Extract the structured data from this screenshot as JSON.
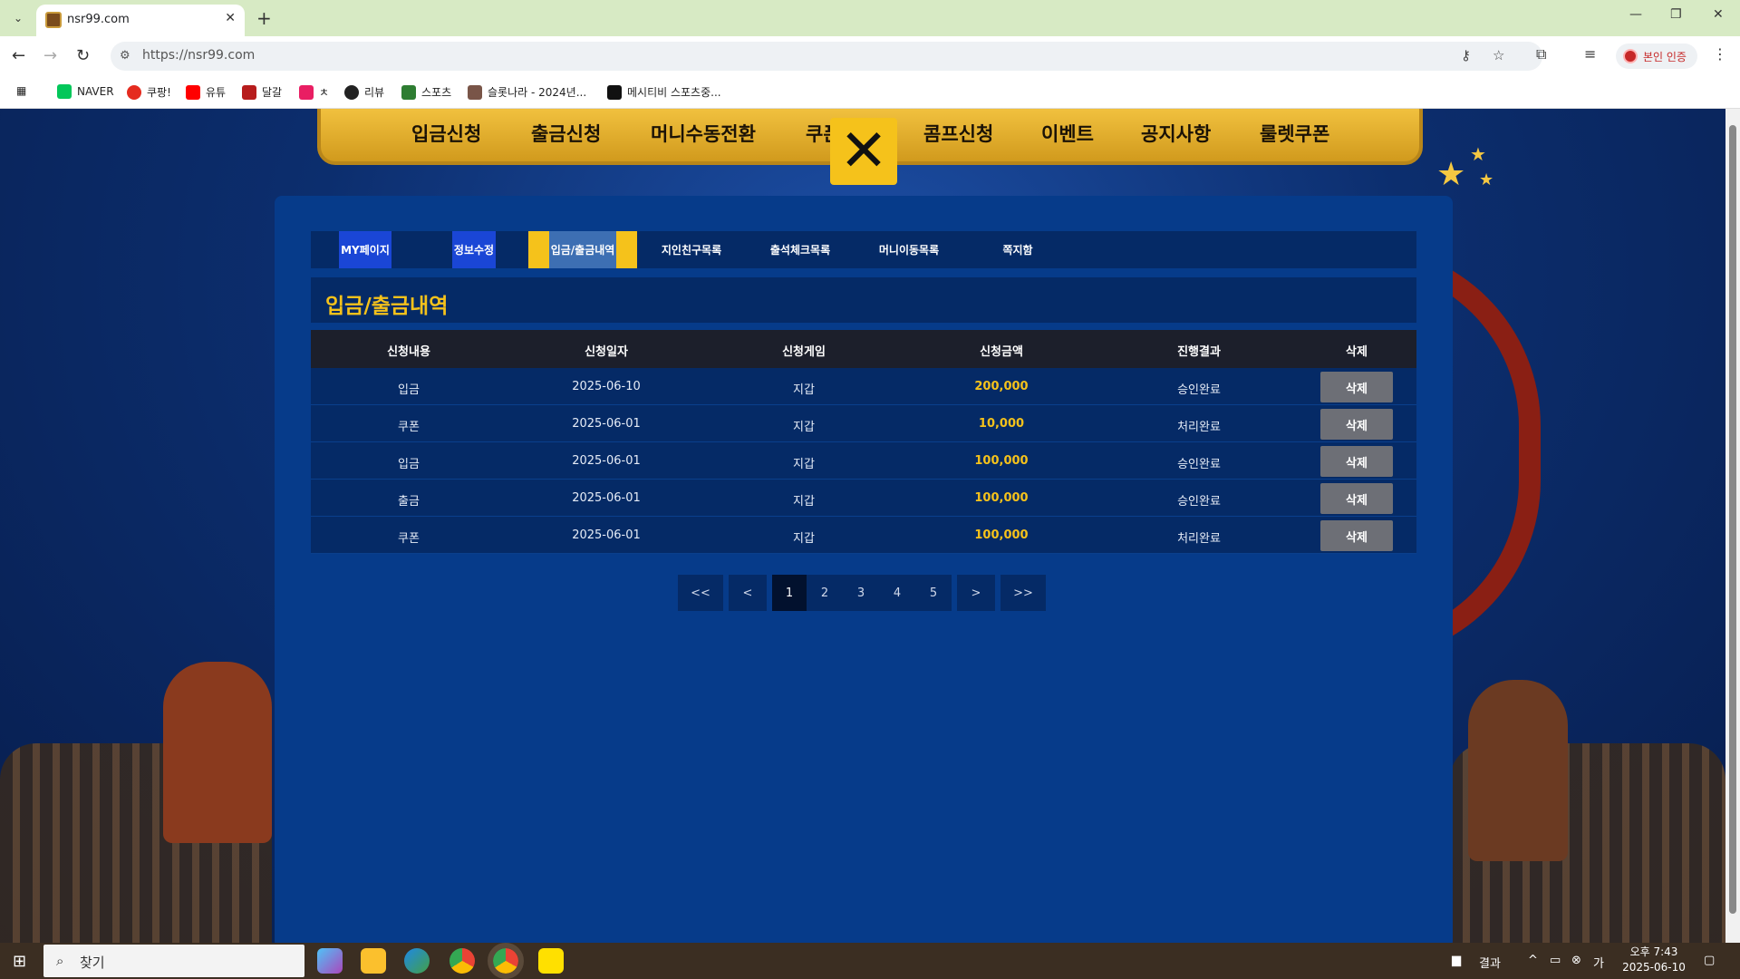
{
  "browser": {
    "tab_title": "nsr99.com",
    "url": "https://nsr99.com",
    "profile_label": "본인 인증",
    "bookmarks": [
      "NAVER",
      "쿠팡!",
      "유튜",
      "달갈",
      "ㅊ",
      "리뷰",
      "스포츠",
      "슬롯나라 - 2024년...",
      "메시티비 스포츠중..."
    ]
  },
  "topnav": {
    "items": [
      "입금신청",
      "출금신청",
      "머니수동전환",
      "쿠폰",
      "콤프신청",
      "이벤트",
      "공지사항",
      "룰렛쿠폰"
    ]
  },
  "subtabs": [
    "MY페이지",
    "정보수정",
    "입금/출금내역",
    "지인친구목록",
    "출석체크목록",
    "머니이동목록",
    "쪽지함"
  ],
  "section_title": "입금/출금내역",
  "table": {
    "headers": [
      "신청내용",
      "신청일자",
      "신청게임",
      "신청금액",
      "진행결과",
      "삭제"
    ],
    "rows": [
      {
        "type": "입금",
        "date": "2025-06-10",
        "game": "지갑",
        "amount": "200,000",
        "result": "승인완료",
        "delete": "삭제"
      },
      {
        "type": "쿠폰",
        "date": "2025-06-01",
        "game": "지갑",
        "amount": "10,000",
        "result": "처리완료",
        "delete": "삭제"
      },
      {
        "type": "입금",
        "date": "2025-06-01",
        "game": "지갑",
        "amount": "100,000",
        "result": "승인완료",
        "delete": "삭제"
      },
      {
        "type": "출금",
        "date": "2025-06-01",
        "game": "지갑",
        "amount": "100,000",
        "result": "승인완료",
        "delete": "삭제"
      },
      {
        "type": "쿠폰",
        "date": "2025-06-01",
        "game": "지갑",
        "amount": "100,000",
        "result": "처리완료",
        "delete": "삭제"
      }
    ]
  },
  "pagination": {
    "first": "<<",
    "prev": "<",
    "pages": [
      "1",
      "2",
      "3",
      "4",
      "5"
    ],
    "current": "1",
    "next": ">",
    "last": ">>"
  },
  "taskbar": {
    "search_placeholder": "찾기",
    "weather_label": "결과",
    "time": "오후 7:43",
    "date": "2025-06-10"
  },
  "colors": {
    "accent": "#f5c21b",
    "panel": "#063b8a",
    "header": "#1c1f2b"
  }
}
